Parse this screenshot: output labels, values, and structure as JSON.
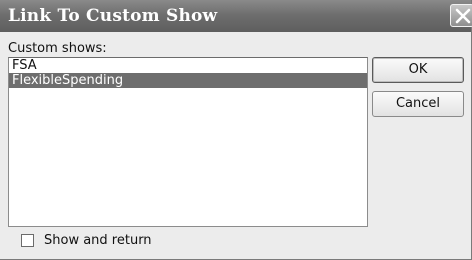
{
  "dialog": {
    "title": "Link To Custom Show",
    "close_icon": "close-x-icon"
  },
  "custom_shows": {
    "label": "Custom shows:",
    "items": [
      {
        "label": "FSA",
        "selected": false
      },
      {
        "label": "FlexibleSpending",
        "selected": true
      }
    ]
  },
  "buttons": {
    "ok_label": "OK",
    "cancel_label": "Cancel"
  },
  "show_and_return": {
    "label": "Show and return",
    "checked": false
  },
  "colors": {
    "titlebar": "#6e6e6e",
    "selection": "#6e6e6e",
    "dialog_bg": "#ececec"
  }
}
